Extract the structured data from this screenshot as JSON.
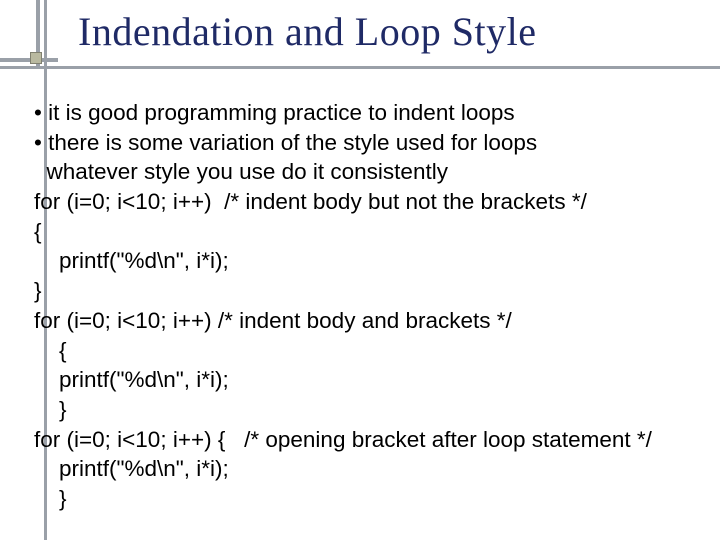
{
  "title": "Indendation and Loop Style",
  "lines": [
    "• it is good programming practice to indent loops",
    "• there is some variation of the style used for loops",
    "  whatever style you use do it consistently",
    "for (i=0; i<10; i++)  /* indent body but not the brackets */",
    "{",
    "    printf(\"%d\\n\", i*i);",
    "}",
    "for (i=0; i<10; i++) /* indent body and brackets */",
    "    {",
    "    printf(\"%d\\n\", i*i);",
    "    }",
    "for (i=0; i<10; i++) {   /* opening bracket after loop statement */",
    "    printf(\"%d\\n\", i*i);",
    "    }"
  ]
}
